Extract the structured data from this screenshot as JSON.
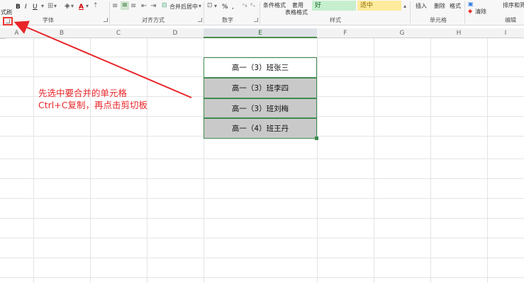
{
  "ribbon": {
    "format_painter": "式刷",
    "bold": "B",
    "italic": "I",
    "underline": "U",
    "font_color_letter": "A",
    "merge_center": "合并后居中",
    "percent": "%",
    "comma": ",",
    "conditional_format": "条件格式",
    "table_style_line1": "套用",
    "table_style_line2": "表格格式",
    "style_good": "好",
    "style_neutral": "适中",
    "insert": "插入",
    "delete": "删除",
    "format": "格式",
    "clear": "清除",
    "sort_filter": "排序和筛",
    "groups": {
      "font": "字体",
      "alignment": "对齐方式",
      "number": "数字",
      "styles": "样式",
      "cells": "单元格",
      "editing": "编辑"
    }
  },
  "columns": [
    "A",
    "B",
    "C",
    "D",
    "E",
    "F",
    "G",
    "H",
    "I"
  ],
  "selected_column": "E",
  "cells": [
    {
      "text": "高一（3）班张三",
      "style": "white"
    },
    {
      "text": "高一（3）班李四",
      "style": "grey"
    },
    {
      "text": "高一（3）班刘梅",
      "style": "grey"
    },
    {
      "text": "高一（4）班王丹",
      "style": "grey"
    }
  ],
  "annotation": {
    "line1": "先选中要合并的单元格",
    "line2": "Ctrl+C复制，再点击剪切板",
    "color": "#e8262a"
  },
  "colors": {
    "selection_border": "#3f8a4f",
    "grey_cell": "#c9c9c9",
    "good_fill": "#c6efce",
    "neutral_fill": "#ffeb9c"
  }
}
